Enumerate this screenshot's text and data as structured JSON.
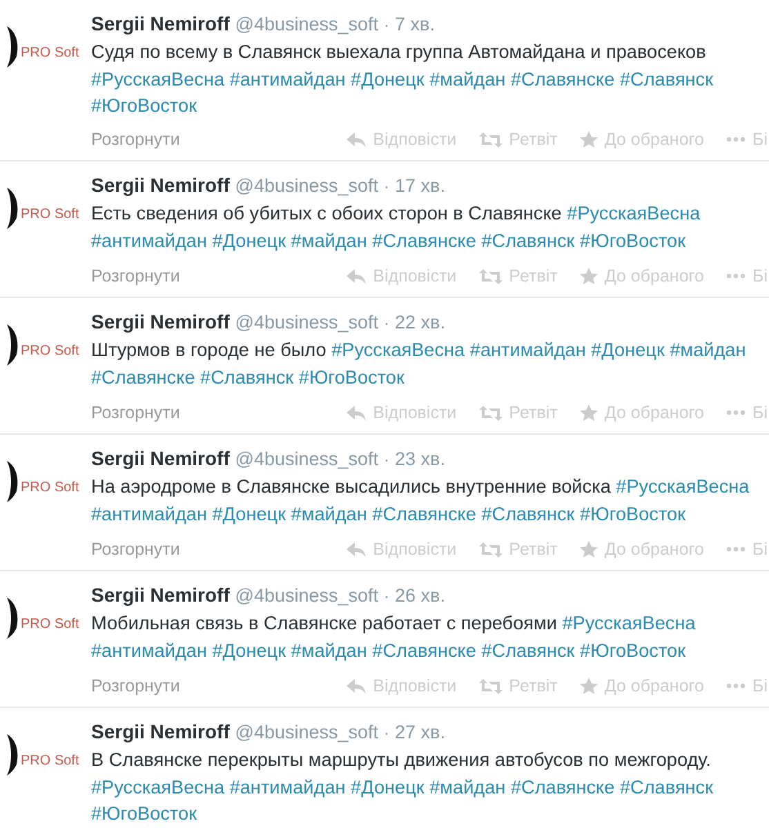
{
  "tweets": [
    {
      "avatar_label": "PRO Soft",
      "name": "Sergii Nemiroff",
      "handle": "@4business_soft",
      "separator": "·",
      "time": "7 хв.",
      "text": "Судя по всему в Славянск выехала группа Автомайдана и правосеков",
      "hashtags": [
        "#РусскаяВесна",
        "#антимайдан",
        "#Донецк",
        "#майдан",
        "#Славянске",
        "#Славянск",
        "#ЮгоВосток"
      ],
      "expand": "Розгорнути",
      "actions": [
        "Відповісти",
        "Ретвіт",
        "До обраного",
        "Бі"
      ]
    },
    {
      "avatar_label": "PRO Soft",
      "name": "Sergii Nemiroff",
      "handle": "@4business_soft",
      "separator": "·",
      "time": "17 хв.",
      "text": "Есть сведения об убитых с обоих сторон в Славянске",
      "hashtags": [
        "#РусскаяВесна",
        "#антимайдан",
        "#Донецк",
        "#майдан",
        "#Славянске",
        "#Славянск",
        "#ЮгоВосток"
      ],
      "expand": "Розгорнути",
      "actions": [
        "Відповісти",
        "Ретвіт",
        "До обраного",
        "Бі"
      ]
    },
    {
      "avatar_label": "PRO Soft",
      "name": "Sergii Nemiroff",
      "handle": "@4business_soft",
      "separator": "·",
      "time": "22 хв.",
      "text": "Штурмов в городе не было",
      "hashtags": [
        "#РусскаяВесна",
        "#антимайдан",
        "#Донецк",
        "#майдан",
        "#Славянске",
        "#Славянск",
        "#ЮгоВосток"
      ],
      "expand": "Розгорнути",
      "actions": [
        "Відповісти",
        "Ретвіт",
        "До обраного",
        "Бі"
      ]
    },
    {
      "avatar_label": "PRO Soft",
      "name": "Sergii Nemiroff",
      "handle": "@4business_soft",
      "separator": "·",
      "time": "23 хв.",
      "text": "На аэродроме в Славянске высадились внутренние войска",
      "hashtags": [
        "#РусскаяВесна",
        "#антимайдан",
        "#Донецк",
        "#майдан",
        "#Славянске",
        "#Славянск",
        "#ЮгоВосток"
      ],
      "expand": "Розгорнути",
      "actions": [
        "Відповісти",
        "Ретвіт",
        "До обраного",
        "Бі"
      ]
    },
    {
      "avatar_label": "PRO Soft",
      "name": "Sergii Nemiroff",
      "handle": "@4business_soft",
      "separator": "·",
      "time": "26 хв.",
      "text": "Мобильная связь в Славянске работает с перебоями",
      "hashtags": [
        "#РусскаяВесна",
        "#антимайдан",
        "#Донецк",
        "#майдан",
        "#Славянске",
        "#Славянск",
        "#ЮгоВосток"
      ],
      "expand": "Розгорнути",
      "actions": [
        "Відповісти",
        "Ретвіт",
        "До обраного",
        "Бі"
      ]
    },
    {
      "avatar_label": "PRO Soft",
      "name": "Sergii Nemiroff",
      "handle": "@4business_soft",
      "separator": "·",
      "time": "27 хв.",
      "text": "В Славянске перекрыты маршруты движения автобусов по межгороду.",
      "hashtags": [
        "#РусскаяВесна",
        "#антимайдан",
        "#Донецк",
        "#майдан",
        "#Славянске",
        "#Славянск",
        "#ЮгоВосток"
      ]
    }
  ]
}
